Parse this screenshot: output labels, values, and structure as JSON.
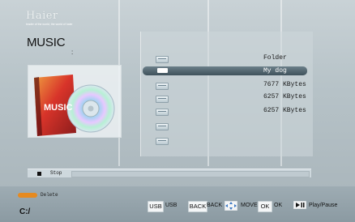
{
  "brand": {
    "name": "Haier",
    "tagline": "leader of the world, the world of haier"
  },
  "page": {
    "title": "MUSIC",
    "title_suffix": ":"
  },
  "cover": {
    "label": "MUSIC"
  },
  "list": {
    "selected_index": 1,
    "entries": [
      "Folder",
      "My dog",
      "7677 KBytes",
      "6257 KBytes",
      "6257 KBytes"
    ]
  },
  "status": {
    "label": "Stop"
  },
  "footer": {
    "delete_label": "Delete",
    "path": "C:/",
    "hints": [
      {
        "key": "USB",
        "text": "USB"
      },
      {
        "key": "BACK",
        "text": "BACK"
      },
      {
        "key": "",
        "text": "MOVE"
      },
      {
        "key": "OK",
        "text": "OK"
      },
      {
        "key": "",
        "text": "Play/Pause"
      }
    ]
  },
  "colors": {
    "delete_key": "#e68a20",
    "selection": "#4a5d67"
  },
  "icons": {
    "cover": "music-cd-icon",
    "move": "arrows-icon",
    "play": "play-pause-icon",
    "file": "file-icon"
  }
}
